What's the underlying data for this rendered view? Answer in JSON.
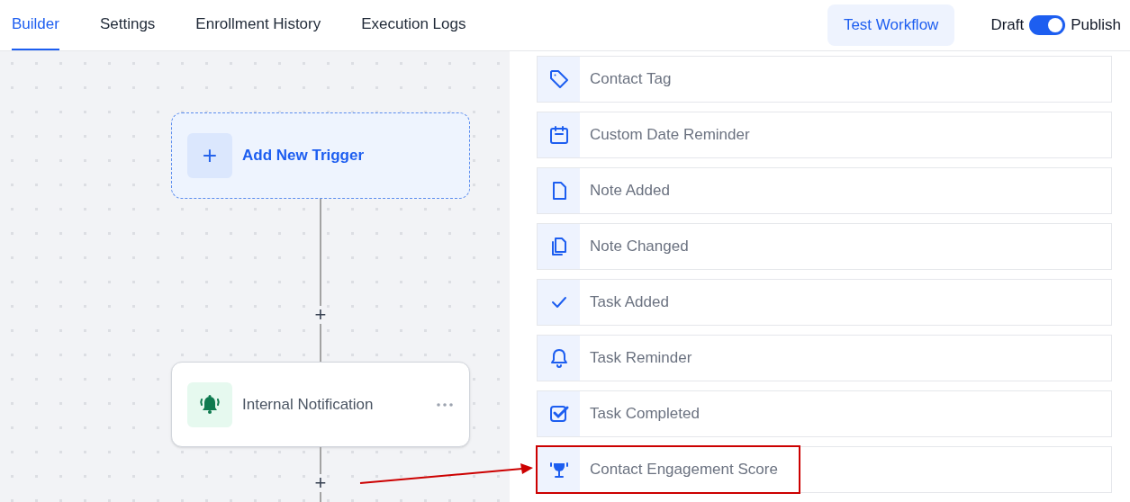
{
  "tabs": [
    {
      "label": "Builder",
      "selected": true
    },
    {
      "label": "Settings",
      "selected": false
    },
    {
      "label": "Enrollment History",
      "selected": false
    },
    {
      "label": "Execution Logs",
      "selected": false
    }
  ],
  "test_button": "Test Workflow",
  "publish_toggle": {
    "off_label": "Draft",
    "on_label": "Publish",
    "on": true
  },
  "canvas": {
    "trigger": {
      "label": "Add New Trigger",
      "plus": "+"
    },
    "plus_1": "+",
    "action": {
      "label": "Internal Notification"
    },
    "plus_2": "+"
  },
  "triggers": [
    {
      "label": "Contact Tag",
      "kind": "tag",
      "highlighted": false
    },
    {
      "label": "Custom Date Reminder",
      "kind": "calendar",
      "highlighted": false
    },
    {
      "label": "Note Added",
      "kind": "file",
      "highlighted": false
    },
    {
      "label": "Note Changed",
      "kind": "files",
      "highlighted": false
    },
    {
      "label": "Task Added",
      "kind": "check",
      "highlighted": false
    },
    {
      "label": "Task Reminder",
      "kind": "bell",
      "highlighted": false
    },
    {
      "label": "Task Completed",
      "kind": "checkbox",
      "highlighted": false
    },
    {
      "label": "Contact Engagement Score",
      "kind": "trophy",
      "highlighted": true
    }
  ]
}
